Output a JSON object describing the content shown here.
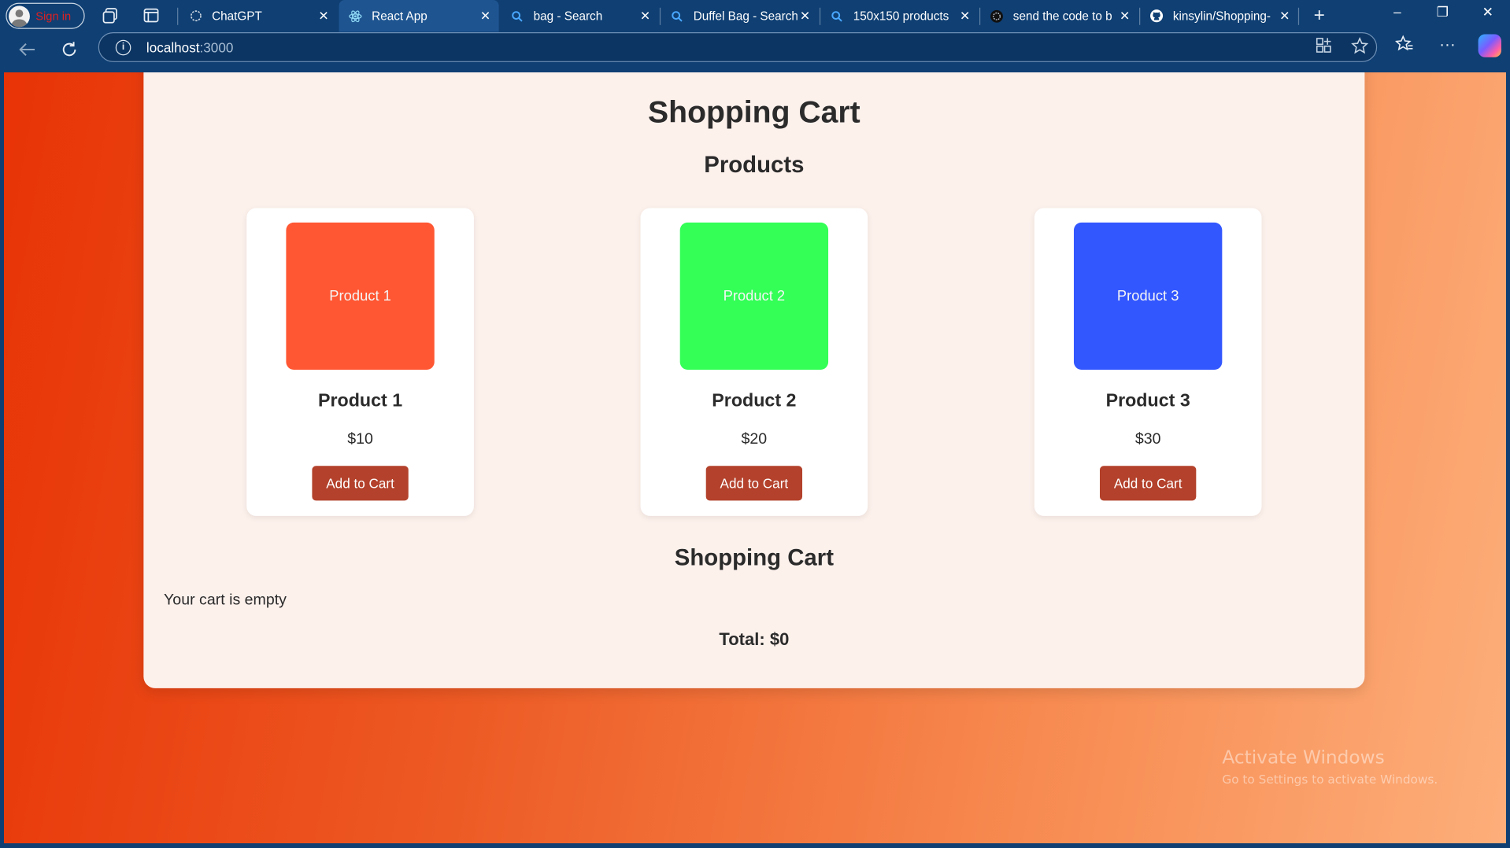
{
  "browser": {
    "signin_label": "Sign in",
    "tabs": [
      {
        "title": "ChatGPT",
        "favicon": "chatgpt-icon"
      },
      {
        "title": "React App",
        "favicon": "react-icon"
      },
      {
        "title": "bag - Search",
        "favicon": "search-icon"
      },
      {
        "title": "Duffel Bag - Search",
        "favicon": "search-icon"
      },
      {
        "title": "150x150 products",
        "favicon": "search-icon"
      },
      {
        "title": "send the code to b",
        "favicon": "chatgpt-icon"
      },
      {
        "title": "kinsylin/Shopping-",
        "favicon": "github-icon"
      }
    ],
    "url_host": "localhost",
    "url_port": ":3000"
  },
  "app": {
    "title": "Shopping Cart",
    "products_heading": "Products",
    "products": [
      {
        "image_label": "Product 1",
        "name": "Product 1",
        "price": "$10",
        "button": "Add to Cart",
        "color": "#ff5733"
      },
      {
        "image_label": "Product 2",
        "name": "Product 2",
        "price": "$20",
        "button": "Add to Cart",
        "color": "#33ff57"
      },
      {
        "image_label": "Product 3",
        "name": "Product 3",
        "price": "$30",
        "button": "Add to Cart",
        "color": "#3357ff"
      }
    ],
    "cart_heading": "Shopping Cart",
    "empty_message": "Your cart is empty",
    "total": "Total: $0"
  },
  "watermark": {
    "title": "Activate Windows",
    "subtitle": "Go to Settings to activate Windows."
  },
  "colors": {
    "button": "#b3412b",
    "browser_frame": "#0f3f73",
    "app_panel": "#fdf1ec"
  }
}
